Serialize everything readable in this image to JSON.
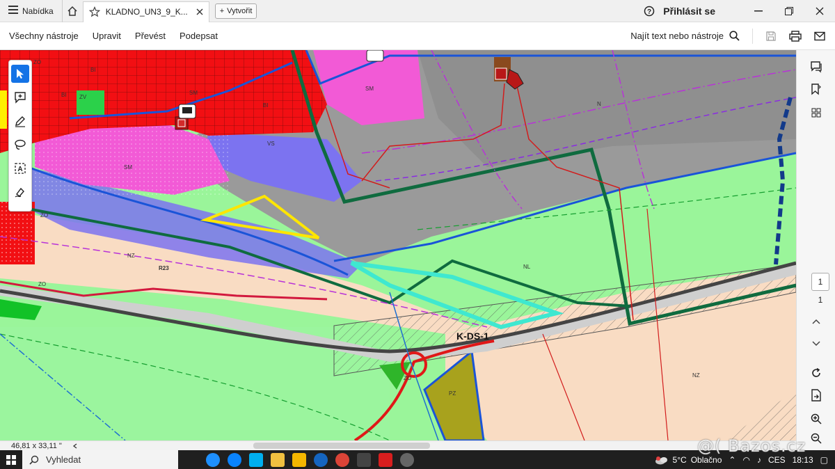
{
  "tabbar": {
    "menu_label": "Nabídka",
    "tab_title": "KLADNO_UN3_9_K...",
    "create_label": "Vytvořit",
    "signin_label": "Přihlásit se"
  },
  "toolbar": {
    "menus": [
      "Všechny nástroje",
      "Upravit",
      "Převést",
      "Podepsat"
    ],
    "find_label": "Najít text nebo nástroje"
  },
  "map": {
    "labels": {
      "zo1": "ZO",
      "bi1": "BI",
      "zv": "ZV",
      "bi2": "BI",
      "sm1": "SM",
      "bi3": "BI",
      "sm2": "SM",
      "vs": "VS",
      "sm3": "SM",
      "zo2": "ZO",
      "nz1": "NZ",
      "r23": "R23",
      "zo3": "ZO",
      "nl": "NL",
      "kds1": "K-DS-1",
      "zo4": "ZO",
      "pz": "PZ",
      "nz2": "NZ",
      "n": "N"
    }
  },
  "pagination": {
    "current": "1",
    "total": "1"
  },
  "status": {
    "dimensions": "46,81 x 33,11 \""
  },
  "taskbar": {
    "search_label": "Vyhledat",
    "weather_temp": "5°C",
    "weather_text": "Oblačno",
    "lang": "CES",
    "time": "18:13"
  },
  "watermark": "@( Bazos.cz",
  "colors": {
    "residential": "#f20f13",
    "mixed": "#f25ad6",
    "transport": "#9a9a9a",
    "meadow": "#9af59a",
    "agri": "#f9dcc3",
    "industrial": "#7c73f0",
    "accent": "#1473e6"
  }
}
